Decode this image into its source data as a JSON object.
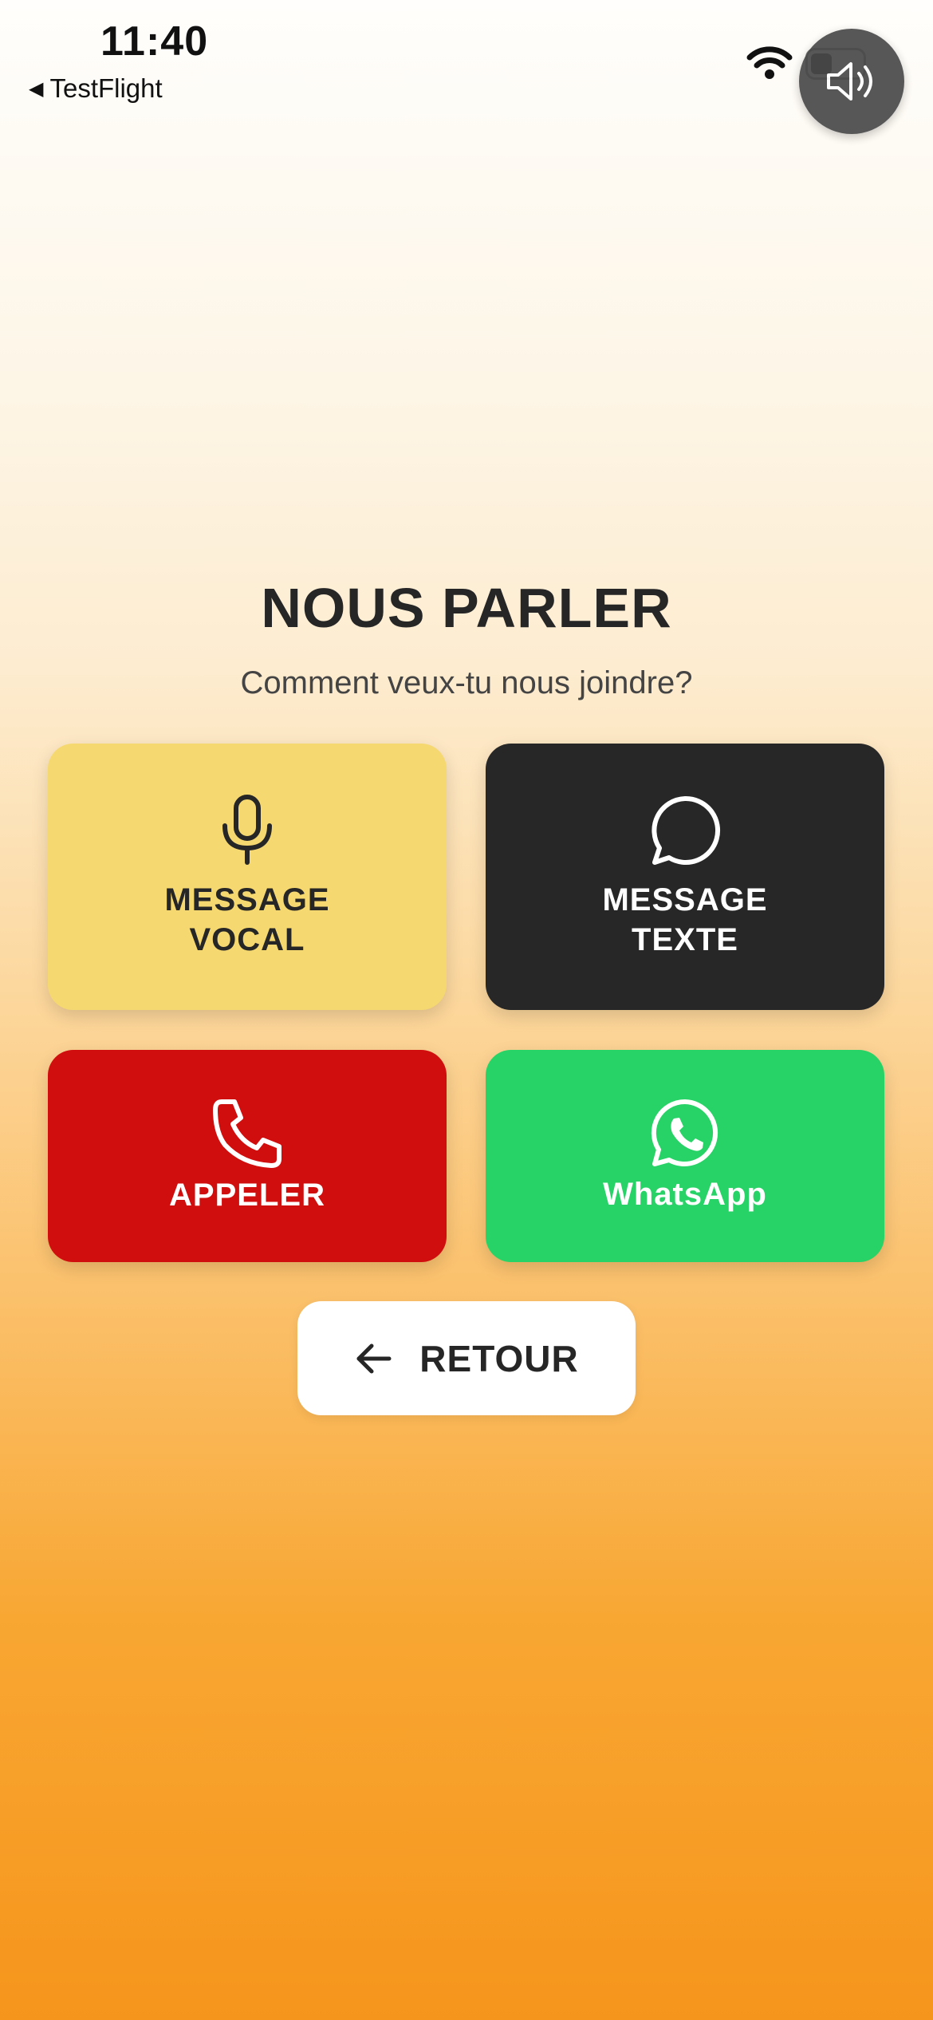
{
  "status_bar": {
    "time": "11:40",
    "back_app": "TestFlight",
    "back_icon": "back-triangle-icon",
    "icons": [
      "wifi-icon",
      "battery-icon"
    ]
  },
  "sound_button": {
    "icon": "speaker-icon"
  },
  "header": {
    "title": "NOUS PARLER",
    "subtitle": "Comment veux-tu nous joindre?"
  },
  "options": [
    {
      "line1": "MESSAGE",
      "line2": "VOCAL",
      "icon": "microphone-icon",
      "color": "#f6d870"
    },
    {
      "line1": "MESSAGE",
      "line2": "TEXTE",
      "icon": "chat-bubble-icon",
      "color": "#272727"
    },
    {
      "label": "APPELER",
      "icon": "phone-icon",
      "color": "#d10e0e"
    },
    {
      "label": "WhatsApp",
      "icon": "whatsapp-icon",
      "color": "#27d366"
    }
  ],
  "back_button": {
    "label": "RETOUR",
    "icon": "arrow-left-icon"
  }
}
